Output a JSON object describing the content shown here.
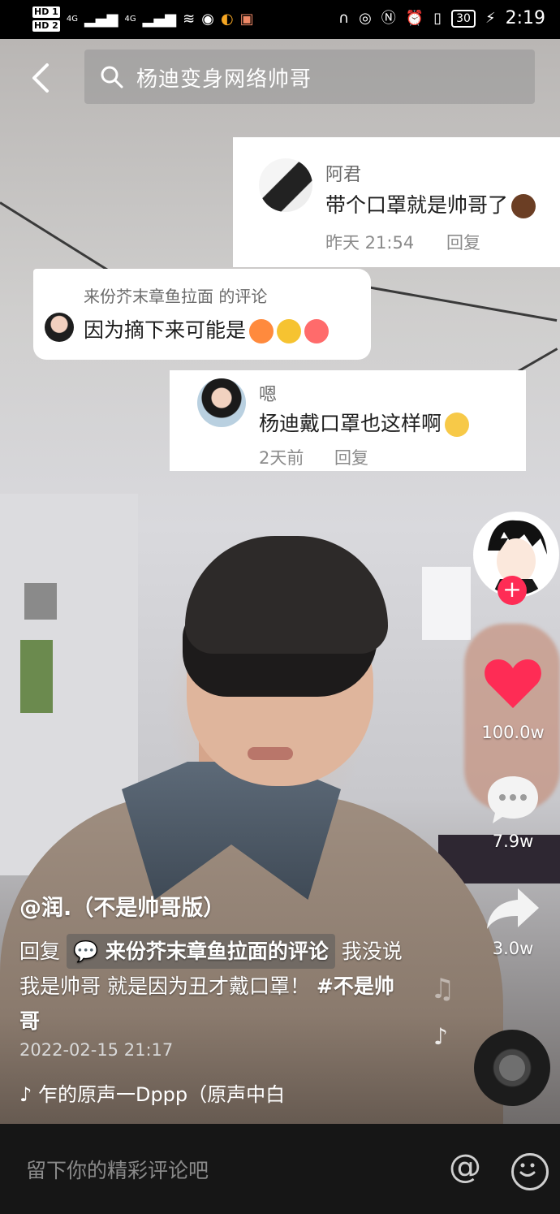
{
  "status_bar": {
    "sim1": "HD 1",
    "sim2": "HD 2",
    "network1": "4G",
    "network2": "4G",
    "battery": "30",
    "time": "2:19"
  },
  "top_nav": {
    "search_placeholder": "杨迪变身网络帅哥"
  },
  "comments": [
    {
      "name": "阿君",
      "text": "带个口罩就是帅哥了",
      "time": "昨天 21:54",
      "reply_label": "回复"
    },
    {
      "header": "来份芥末章鱼拉面 的评论",
      "text": "因为摘下来可能是"
    },
    {
      "name": "嗯",
      "text": "杨迪戴口罩也这样啊",
      "time": "2天前",
      "reply_label": "回复"
    }
  ],
  "rail": {
    "likes": "100.0w",
    "comments": "7.9w",
    "shares": "3.0w"
  },
  "caption": {
    "author": "@润.（不是帅哥版）",
    "reply_prefix": "回复",
    "reply_target": "来份芥末章鱼拉面的评论",
    "body": "我没说我是帅哥 就是因为丑才戴口罩！",
    "hashtag": "#不是帅哥",
    "date": "2022-02-15 21:17",
    "music": "乍的原声一Dppp（原声中白"
  },
  "bottom_bar": {
    "comment_placeholder": "留下你的精彩评论吧",
    "at_symbol": "@"
  },
  "colors": {
    "accent": "#fe2c55",
    "card_bg": "#ffffff"
  }
}
